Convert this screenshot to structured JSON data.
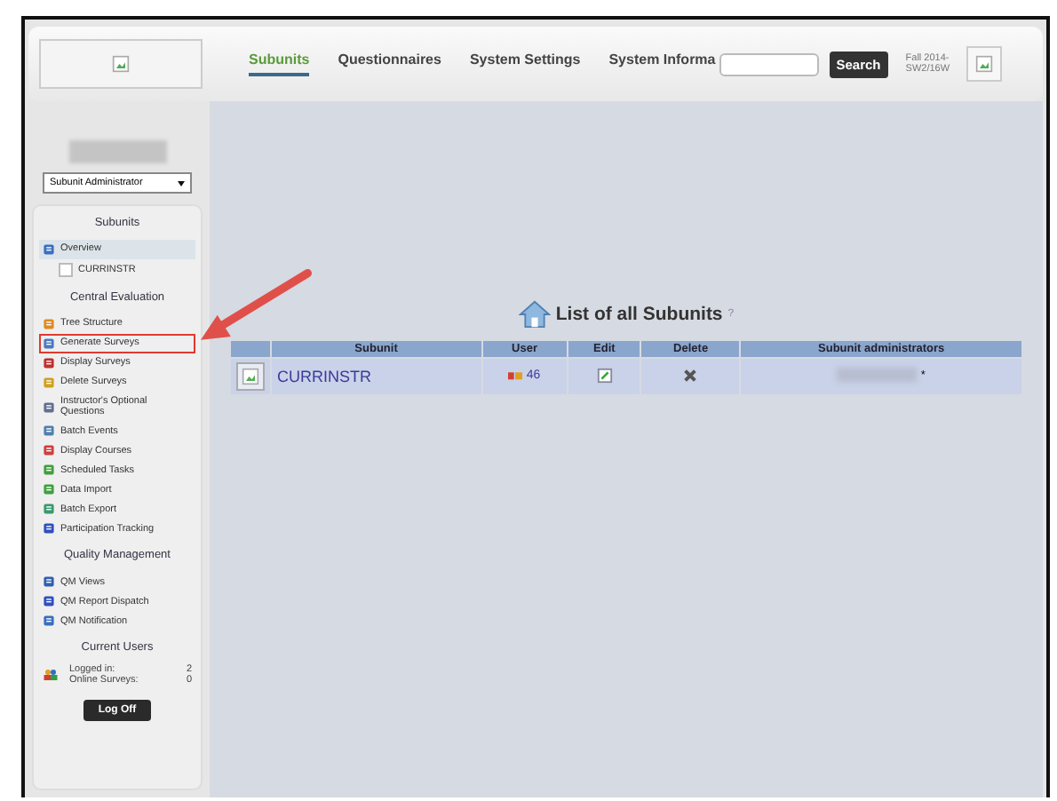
{
  "header": {
    "nav": [
      {
        "label": "Subunits",
        "selected": true
      },
      {
        "label": "Questionnaires",
        "selected": false
      },
      {
        "label": "System Settings",
        "selected": false
      },
      {
        "label": "System Informa",
        "selected": false
      }
    ],
    "search_button": "Search",
    "term": "Fall 2014-\nSW2/16W"
  },
  "role_select": {
    "value": "Subunit Administrator"
  },
  "sidebar": {
    "sections": [
      {
        "title": "Subunits",
        "items": [
          {
            "label": "Overview",
            "selected": true,
            "highlighted": false,
            "children": [
              {
                "label": "CURRINSTR",
                "selected": false,
                "highlighted": false
              }
            ]
          }
        ]
      },
      {
        "title": "Central Evaluation",
        "items": [
          {
            "label": "Tree Structure",
            "selected": false,
            "highlighted": false
          },
          {
            "label": "Generate Surveys",
            "selected": false,
            "highlighted": true
          },
          {
            "label": "Display Surveys",
            "selected": false,
            "highlighted": false
          },
          {
            "label": "Delete Surveys",
            "selected": false,
            "highlighted": false
          },
          {
            "label": "Instructor's Optional Questions",
            "selected": false,
            "highlighted": false
          },
          {
            "label": "Batch Events",
            "selected": false,
            "highlighted": false
          },
          {
            "label": "Display Courses",
            "selected": false,
            "highlighted": false
          },
          {
            "label": "Scheduled Tasks",
            "selected": false,
            "highlighted": false
          },
          {
            "label": "Data Import",
            "selected": false,
            "highlighted": false
          },
          {
            "label": "Batch Export",
            "selected": false,
            "highlighted": false
          },
          {
            "label": "Participation Tracking",
            "selected": false,
            "highlighted": false
          }
        ]
      },
      {
        "title": "Quality Management",
        "items": [
          {
            "label": "QM Views",
            "selected": false,
            "highlighted": false
          },
          {
            "label": "QM Report Dispatch",
            "selected": false,
            "highlighted": false
          },
          {
            "label": "QM Notification",
            "selected": false,
            "highlighted": false
          }
        ]
      }
    ],
    "current_users": {
      "title": "Current Users",
      "stats": [
        {
          "label": "Logged in:",
          "value": "2"
        },
        {
          "label": "Online Surveys:",
          "value": "0"
        }
      ]
    },
    "logoff_button": "Log Off"
  },
  "main": {
    "title": "List of all Subunits",
    "help": "?",
    "table": {
      "columns": [
        "Subunit",
        "User",
        "Edit",
        "Delete",
        "Subunit administrators"
      ],
      "rows": [
        {
          "name": "CURRINSTR",
          "users": "46",
          "admin_suffix": "*"
        }
      ]
    }
  }
}
